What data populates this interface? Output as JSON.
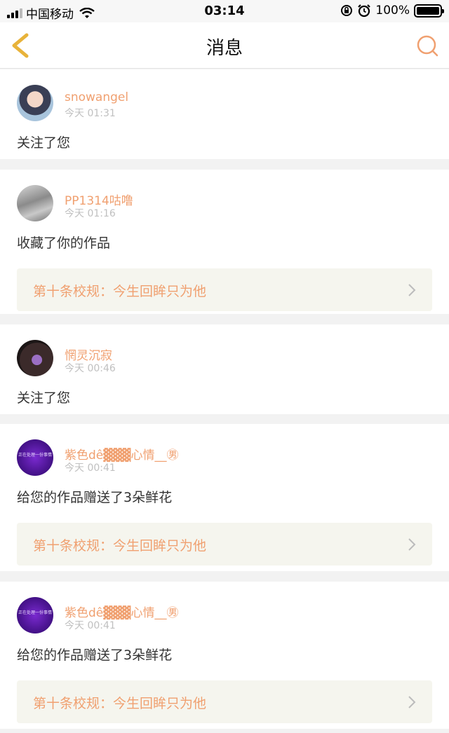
{
  "status_bar": {
    "carrier": "中国移动",
    "time": "03:14",
    "battery": "100%",
    "battery_level": 1.0,
    "icons": [
      "signal-icon",
      "wifi-icon",
      "rotation-lock-icon",
      "alarm-icon",
      "battery-icon"
    ]
  },
  "nav": {
    "title": "消息",
    "back_icon": "chevron-left-icon",
    "search_icon": "search-icon"
  },
  "colors": {
    "accent": "#f0a070",
    "back_arrow": "#e8b33a",
    "timestamp": "#c0c0c0",
    "ref_bg": "#f5f5ee"
  },
  "messages": [
    {
      "username": "snowangel",
      "time": "今天 01:31",
      "text": "关注了您",
      "avatar": "anime-girl-avatar"
    },
    {
      "username": "PP1314咕噜",
      "time": "今天 01:16",
      "text": "收藏了你的作品",
      "avatar": "figure-avatar",
      "ref": "第十条校规：今生回眸只为他"
    },
    {
      "username": "惘灵沉寂",
      "time": "今天 00:46",
      "text": "关注了您",
      "avatar": "dark-figure-avatar"
    },
    {
      "username": "紫色dê▓▓▓心情__㊚",
      "time": "今天 00:41",
      "text": "给您的作品赠送了3朵鲜花",
      "avatar": "purple-text-avatar",
      "avatar_text": "正在处理一份事情",
      "ref": "第十条校规：今生回眸只为他"
    },
    {
      "username": "紫色dê▓▓▓心情__㊚",
      "time": "今天 00:41",
      "text": "给您的作品赠送了3朵鲜花",
      "avatar": "purple-text-avatar",
      "avatar_text": "正在处理一份事情",
      "ref": "第十条校规：今生回眸只为他"
    }
  ]
}
